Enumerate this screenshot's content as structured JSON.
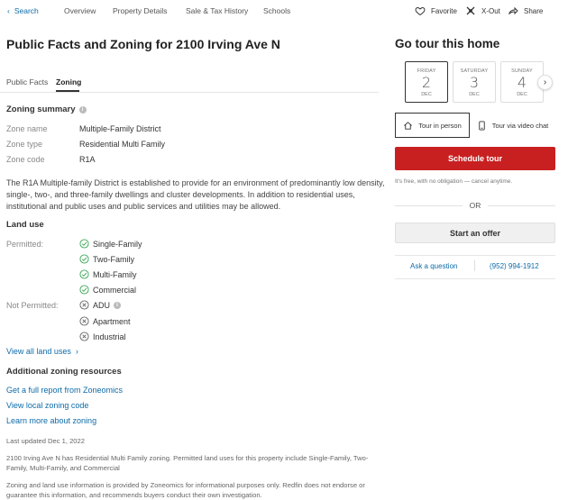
{
  "nav": {
    "back_label": "Search",
    "links": [
      "Overview",
      "Property Details",
      "Sale & Tax History",
      "Schools"
    ],
    "actions": [
      {
        "label": "Favorite",
        "icon": "heart-icon"
      },
      {
        "label": "X-Out",
        "icon": "x-out-icon"
      },
      {
        "label": "Share",
        "icon": "share-icon"
      }
    ]
  },
  "main": {
    "title": "Public Facts and Zoning for 2100 Irving Ave N",
    "tabs": [
      {
        "label": "Public Facts",
        "active": false
      },
      {
        "label": "Zoning",
        "active": true
      }
    ],
    "zoning_summary": {
      "heading": "Zoning summary",
      "rows": [
        {
          "label": "Zone name",
          "value": "Multiple-Family District"
        },
        {
          "label": "Zone type",
          "value": "Residential Multi Family"
        },
        {
          "label": "Zone code",
          "value": "R1A"
        }
      ],
      "description": "The R1A Multiple-family District is established to provide for an environment of predominantly low density, single-, two-, and three-family dwellings and cluster developments. In addition to residential uses, institutional and public uses and public services and utilities may be allowed."
    },
    "land_use": {
      "heading": "Land use",
      "permitted_label": "Permitted:",
      "permitted": [
        "Single-Family",
        "Two-Family",
        "Multi-Family",
        "Commercial"
      ],
      "not_permitted_label": "Not Permitted:",
      "not_permitted": [
        "ADU",
        "Apartment",
        "Industrial"
      ],
      "view_all": "View all land uses"
    },
    "resources": {
      "heading": "Additional zoning resources",
      "links": [
        "Get a full report from Zoneomics",
        "View local zoning code",
        "Learn more about zoning"
      ]
    },
    "last_updated": "Last updated Dec 1, 2022",
    "footnote1": "2100 Irving Ave N has Residential Multi Family zoning. Permitted land uses for this property include Single-Family, Two-Family, Multi-Family, and Commercial",
    "footnote2": "Zoning and land use information is provided by Zoneomics for informational purposes only. Redfin does not endorse or guarantee this information, and recommends buyers conduct their own investigation."
  },
  "tour": {
    "title": "Go tour this home",
    "dates": [
      {
        "day": "FRIDAY",
        "num": "2",
        "month": "DEC",
        "selected": true
      },
      {
        "day": "SATURDAY",
        "num": "3",
        "month": "DEC",
        "selected": false
      },
      {
        "day": "SUNDAY",
        "num": "4",
        "month": "DEC",
        "selected": false
      }
    ],
    "options": [
      {
        "label": "Tour in person",
        "selected": true
      },
      {
        "label": "Tour via video chat",
        "selected": false
      }
    ],
    "schedule_label": "Schedule tour",
    "free_note": "It's free, with no obligation — cancel anytime.",
    "or_label": "OR",
    "offer_label": "Start an offer",
    "ask_label": "Ask a question",
    "phone": "(952) 994-1912"
  },
  "colors": {
    "primary_red": "#c82021",
    "link_blue": "#0d6ba8",
    "check_green": "#3aa757"
  }
}
